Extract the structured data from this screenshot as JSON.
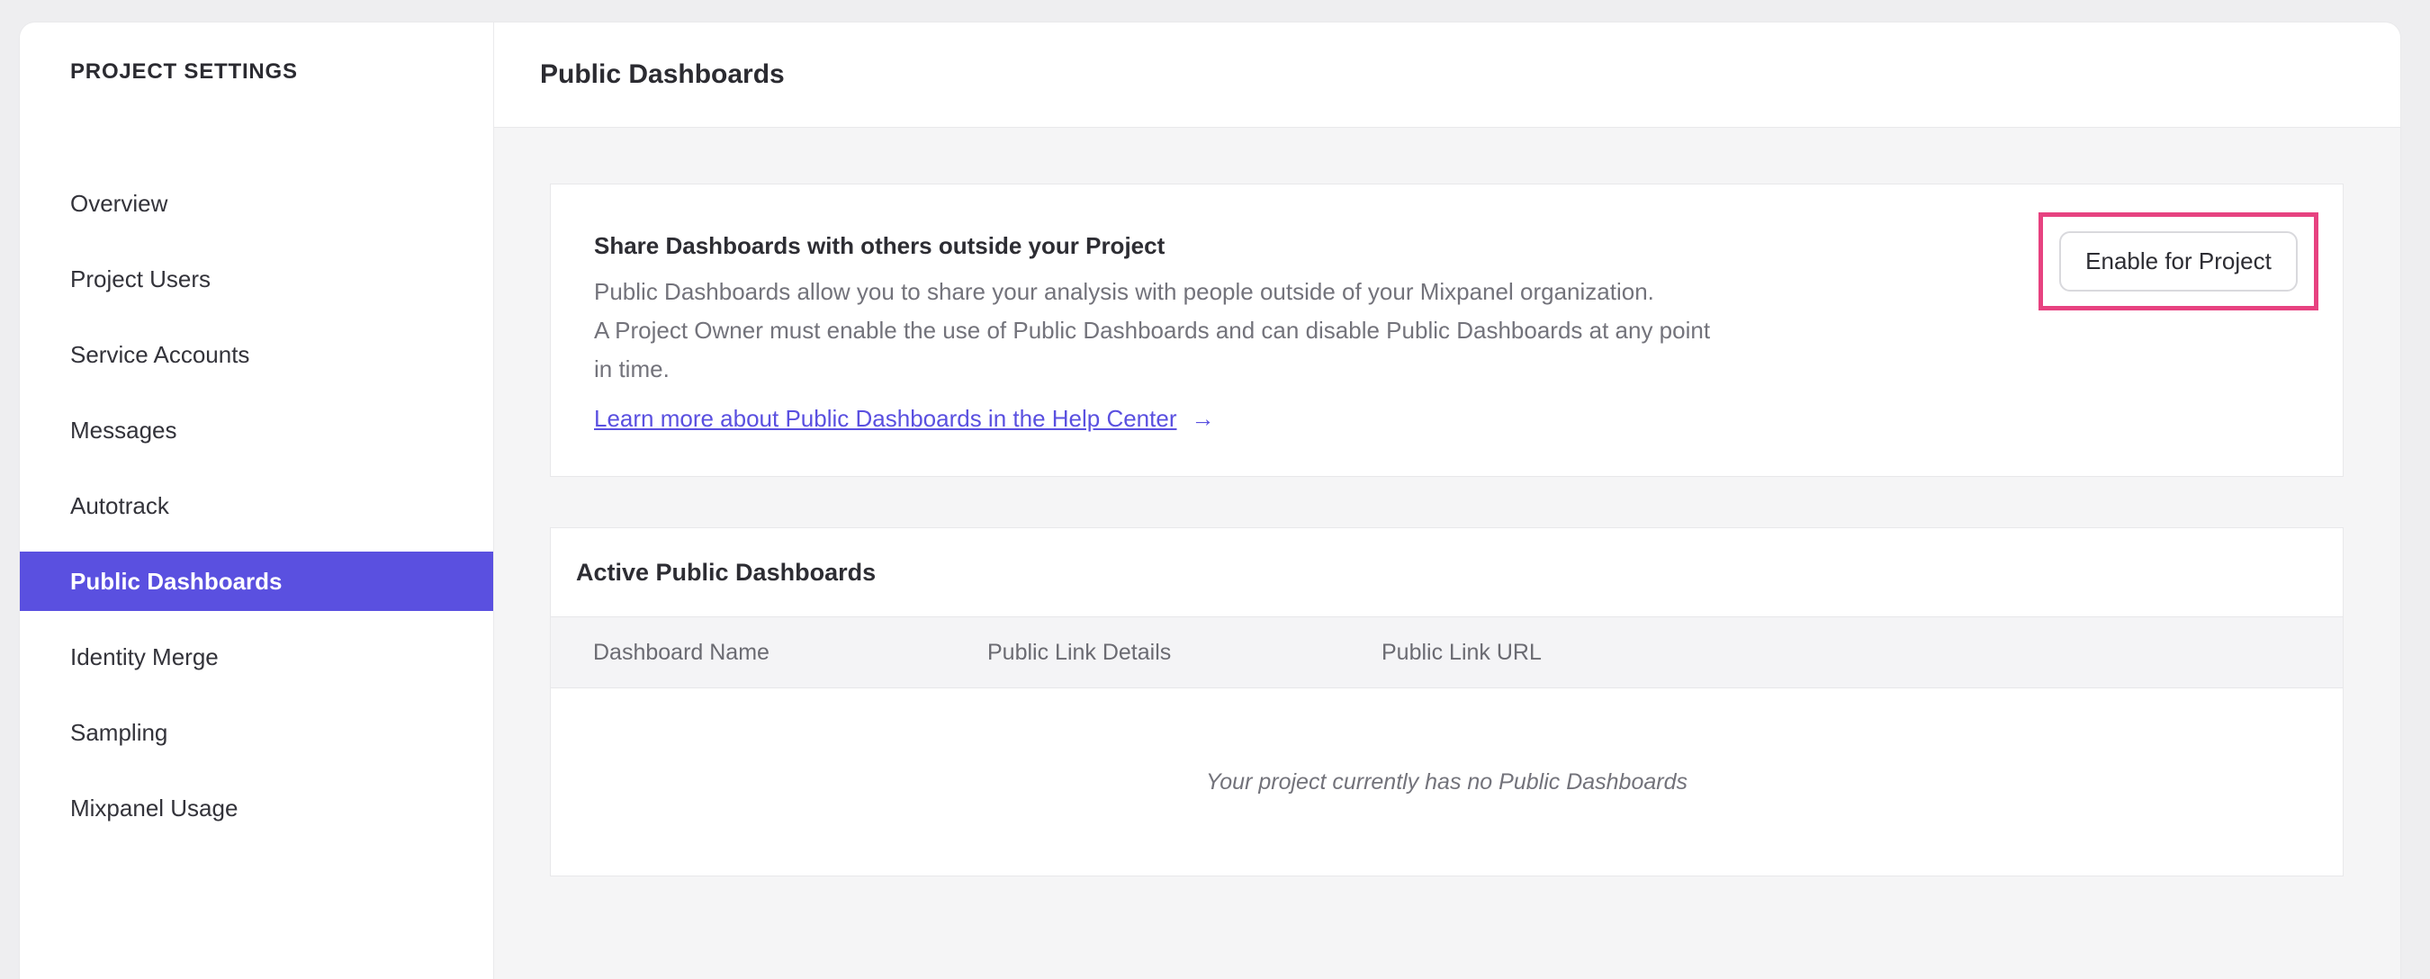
{
  "colors": {
    "accent": "#5a50e0",
    "link": "#5a50e0",
    "annotation": "#e74280"
  },
  "sidebar": {
    "title": "PROJECT SETTINGS",
    "items": [
      {
        "label": "Overview",
        "selected": false
      },
      {
        "label": "Project Users",
        "selected": false
      },
      {
        "label": "Service Accounts",
        "selected": false
      },
      {
        "label": "Messages",
        "selected": false
      },
      {
        "label": "Autotrack",
        "selected": false
      },
      {
        "label": "Public Dashboards",
        "selected": true
      },
      {
        "label": "Identity Merge",
        "selected": false
      },
      {
        "label": "Sampling",
        "selected": false
      },
      {
        "label": "Mixpanel Usage",
        "selected": false
      }
    ]
  },
  "header": {
    "title": "Public Dashboards"
  },
  "share_card": {
    "heading": "Share Dashboards with others outside your Project",
    "body_lines": [
      "Public Dashboards allow you to share your analysis with people outside of your Mixpanel organization.",
      "A Project Owner must enable the use of Public Dashboards and can disable Public Dashboards at any point",
      "in time."
    ],
    "link_label": "Learn more about Public Dashboards in the Help Center",
    "link_arrow": "→",
    "button_label": "Enable for Project"
  },
  "dashboards_card": {
    "title": "Active Public Dashboards",
    "columns": [
      "Dashboard Name",
      "Public Link Details",
      "Public Link URL"
    ],
    "rows": [],
    "empty_message": "Your project currently has no Public Dashboards"
  }
}
